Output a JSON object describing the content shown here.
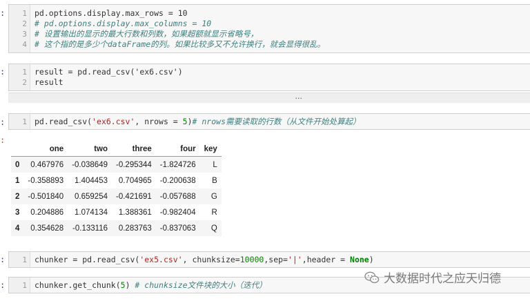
{
  "cells": {
    "cell1": {
      "prompt": ":",
      "lines": [
        {
          "num": "1",
          "code": "pd.options.display.max_rows = 10"
        },
        {
          "num": "2",
          "code": "# pd.options.display.max_columns = 10"
        },
        {
          "num": "3",
          "code": "# 设置输出的显示的最大行数和列数，如果超额就显示省略号，"
        },
        {
          "num": "4",
          "code": "# 这个指的是多少个dataFrame的列。如果比较多又不允许换行，就会显得很乱。"
        }
      ]
    },
    "cell2": {
      "prompt": ":",
      "lines": [
        {
          "num": "1",
          "code": "result = pd.read_csv('ex6.csv')"
        },
        {
          "num": "2",
          "code": "result"
        }
      ],
      "collapsed_output": "..."
    },
    "cell3": {
      "prompt": ":",
      "out_prompt": ":",
      "lines": [
        {
          "num": "1",
          "code_pre": "pd.read_csv(",
          "str": "'ex6.csv'",
          "code_mid": ", nrows = ",
          "num_lit": "5",
          "code_post": ")",
          "comment": "# nrows需要读取的行数（从文件开始处算起）"
        }
      ]
    },
    "cell4": {
      "prompt": ":",
      "lines": [
        {
          "num": "1",
          "code_pre": "chunker = pd.read_csv(",
          "str": "'ex5.csv'",
          "code_mid": ", chunksize=",
          "num_lit": "10000",
          "code_mid2": ",sep=",
          "str2": "'|'",
          "code_mid3": ",header = ",
          "kw": "None",
          "code_post": ")"
        }
      ]
    },
    "cell5": {
      "prompt": ":",
      "lines": [
        {
          "num": "1",
          "code_pre": "chunker.get_chunk(",
          "num_lit": "5",
          "code_post": ") ",
          "comment": "# chunksize文件块的大小（迭代）"
        }
      ]
    }
  },
  "dataframe": {
    "columns": [
      "",
      "one",
      "two",
      "three",
      "four",
      "key"
    ],
    "rows": [
      [
        "0",
        "0.467976",
        "-0.038649",
        "-0.295344",
        "-1.824726",
        "L"
      ],
      [
        "1",
        "-0.358893",
        "1.404453",
        "0.704965",
        "-0.200638",
        "B"
      ],
      [
        "2",
        "-0.501840",
        "0.659254",
        "-0.421691",
        "-0.057688",
        "G"
      ],
      [
        "3",
        "0.204886",
        "1.074134",
        "1.388361",
        "-0.982404",
        "R"
      ],
      [
        "4",
        "0.354628",
        "-0.133116",
        "0.283763",
        "-0.837063",
        "Q"
      ]
    ]
  },
  "watermark": {
    "text": "大数据时代之应天归德",
    "icon": "wechat-icon"
  },
  "colors": {
    "prompt": "#303f9f",
    "out_prompt": "#d84315",
    "comment": "#408080",
    "string": "#ba2121",
    "number": "#008800"
  }
}
